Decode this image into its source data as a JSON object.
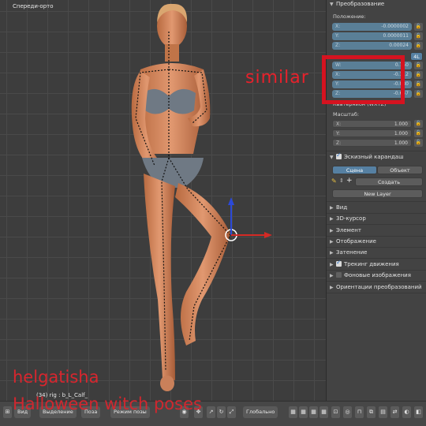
{
  "viewport": {
    "view_name": "Спереди-орто",
    "rig_info": "(34) rig : b_L_Calf_"
  },
  "panel": {
    "transform_header": "Преобразование",
    "location_label": "Положение:",
    "location": [
      {
        "axis": "X:",
        "value": "-0.0000002"
      },
      {
        "axis": "Y:",
        "value": "0.0000011"
      },
      {
        "axis": "Z:",
        "value": "0.00024"
      }
    ],
    "rot_mode": "4L",
    "rotation": [
      {
        "axis": "W:",
        "value": "0.750"
      },
      {
        "axis": "X:",
        "value": "-0.112"
      },
      {
        "axis": "Y:",
        "value": "-0.080"
      },
      {
        "axis": "Z:",
        "value": "-0.647"
      }
    ],
    "rotation_label": "Кватернион (WXYZ)",
    "scale_label": "Масштаб:",
    "scale": [
      {
        "axis": "X:",
        "value": "1.000"
      },
      {
        "axis": "Y:",
        "value": "1.000"
      },
      {
        "axis": "Z:",
        "value": "1.000"
      }
    ],
    "grease_header": "Эскизный карандаш",
    "tab_scene": "Сцена",
    "tab_object": "Объект",
    "create_label": "Создать",
    "new_layer_label": "New Layer",
    "sections": [
      {
        "label": "Вид"
      },
      {
        "label": "3D-курсор"
      },
      {
        "label": "Элемент"
      },
      {
        "label": "Отображение"
      },
      {
        "label": "Затенение"
      },
      {
        "label": "Трекинг движения",
        "checkbox": "on"
      },
      {
        "label": "Фоновые изображения",
        "checkbox": "off"
      },
      {
        "label": "Ориентации преобразований"
      }
    ],
    "lock_glyph": "🔓"
  },
  "header": {
    "view_menu": "Вид",
    "select_menu": "Выделение",
    "pose_menu": "Поза",
    "mode_select": "Режим позы",
    "orientation_select": "Глобально"
  },
  "overlay": {
    "annotation": "similar",
    "watermark_author": "helgatisha",
    "watermark_title": "Halloween witch poses",
    "accent": "#d51320"
  }
}
